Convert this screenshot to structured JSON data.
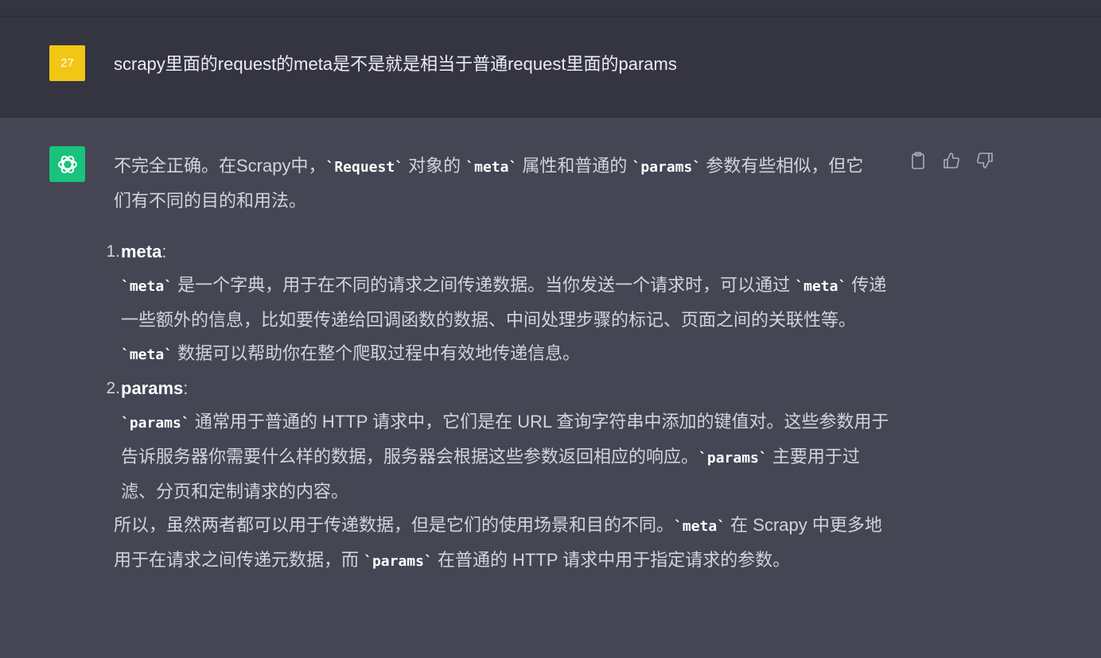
{
  "user": {
    "avatar_text": "27",
    "message": "scrapy里面的request的meta是不是就是相当于普通request里面的params"
  },
  "assistant": {
    "intro": {
      "t1": "不完全正确。在Scrapy中，",
      "c1": "`Request`",
      "t2": " 对象的 ",
      "c2": "`meta`",
      "t3": " 属性和普通的 ",
      "c3": "`params`",
      "t4": " 参数有些相似，但它们有不同的目的和用法。"
    },
    "items": [
      {
        "num": "1.",
        "term": "meta",
        "colon": ":",
        "c1": "`meta`",
        "t1": " 是一个字典，用于在不同的请求之间传递数据。当你发送一个请求时，可以通过 ",
        "c2": "`meta`",
        "t2": " 传递一些额外的信息，比如要传递给回调函数的数据、中间处理步骤的标记、页面之间的关联性等。",
        "c3": "`meta`",
        "t3": " 数据可以帮助你在整个爬取过程中有效地传递信息。"
      },
      {
        "num": "2.",
        "term": "params",
        "colon": ":",
        "c1": "`params`",
        "t1": " 通常用于普通的 HTTP 请求中，它们是在 URL 查询字符串中添加的键值对。这些参数用于告诉服务器你需要什么样的数据，服务器会根据这些参数返回相应的响应。",
        "c2": "`params`",
        "t2": " 主要用于过滤、分页和定制请求的内容。"
      }
    ],
    "conclusion": {
      "t1": "所以，虽然两者都可以用于传递数据，但是它们的使用场景和目的不同。",
      "c1": "`meta`",
      "t2": " 在 Scrapy 中更多地用于在请求之间传递元数据，而 ",
      "c2": "`params`",
      "t3": " 在普通的 HTTP 请求中用于指定请求的参数。"
    },
    "actions": [
      "clipboard-icon",
      "thumbs-up-icon",
      "thumbs-down-icon"
    ]
  },
  "colors": {
    "user_bg": "#343541",
    "assistant_bg": "#444654",
    "user_avatar": "#f2c614",
    "assistant_avatar": "#19c37d"
  }
}
